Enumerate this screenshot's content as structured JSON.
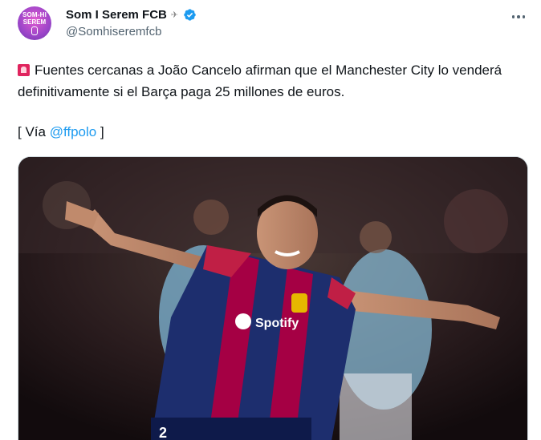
{
  "author": {
    "avatar_line1": "SOM-HI",
    "avatar_line2": "SEREM",
    "display_name": "Som I Serem FCB",
    "handle": "@Somhiseremfcb",
    "verified_color": "#1d9bf0"
  },
  "tweet": {
    "text": "Fuentes cercanas a João Cancelo afirman que el Manchester City lo venderá definitivamente si el Barça paga 25 millones de euros.",
    "via_prefix": "[ Vía ",
    "via_mention": "@ffpolo",
    "via_suffix": " ]"
  },
  "icons": {
    "leading_emoji": "siren-icon",
    "menu": "more-options-icon"
  },
  "media": {
    "jersey_number": "2",
    "sponsor": "Spotify"
  },
  "colors": {
    "link": "#1d9bf0",
    "text": "#0f1419",
    "secondary": "#536471",
    "blaugrana_red": "#a50044",
    "blaugrana_blue": "#004d98"
  }
}
